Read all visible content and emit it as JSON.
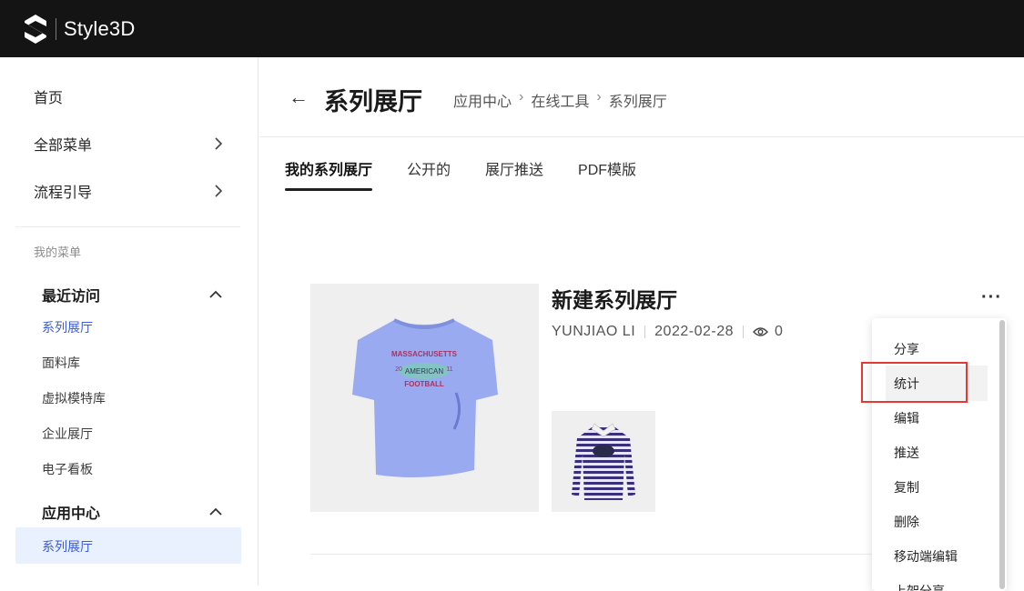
{
  "app": {
    "brand": "Style3D"
  },
  "sidebar": {
    "home": "首页",
    "all_menu": "全部菜单",
    "process_guide": "流程引导",
    "my_menu_label": "我的菜单",
    "recent": {
      "label": "最近访问",
      "items": [
        "系列展厅",
        "面料库",
        "虚拟模特库",
        "企业展厅",
        "电子看板"
      ]
    },
    "app_center": {
      "label": "应用中心",
      "items": [
        "系列展厅"
      ]
    }
  },
  "header": {
    "back": "←",
    "title": "系列展厅",
    "breadcrumb": [
      "应用中心",
      "在线工具",
      "系列展厅"
    ],
    "breadcrumb_sep": "›"
  },
  "tabs": [
    {
      "label": "我的系列展厅",
      "active": true
    },
    {
      "label": "公开的",
      "active": false
    },
    {
      "label": "展厅推送",
      "active": false
    },
    {
      "label": "PDF模版",
      "active": false
    }
  ],
  "card": {
    "title": "新建系列展厅",
    "author": "YUNJIAO  LI",
    "date": "2022-02-28",
    "views": "0",
    "more": "···",
    "tshirt_text": {
      "line1": "MASSACHUSETTS",
      "line2": "AMERICAN",
      "line3": "FOOTBALL",
      "left": "20",
      "right": "11"
    }
  },
  "dropdown": {
    "items": [
      "分享",
      "统计",
      "编辑",
      "推送",
      "复制",
      "删除",
      "移动端编辑",
      "上架分享"
    ]
  },
  "colors": {
    "accent": "#3b5bdb",
    "topbar": "#141414",
    "highlight": "#e53935"
  }
}
